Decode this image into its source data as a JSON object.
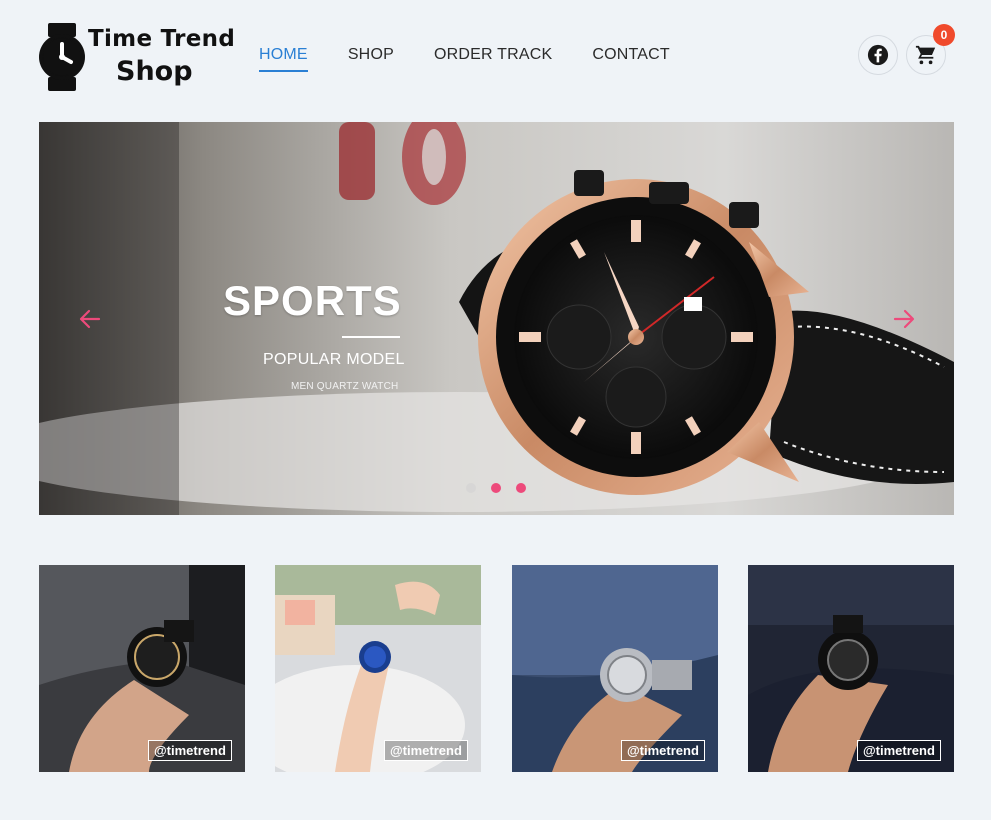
{
  "brand": {
    "line1": "Time Trend",
    "line2": "Shop"
  },
  "nav": {
    "items": [
      {
        "label": "HOME",
        "active": true
      },
      {
        "label": "SHOP",
        "active": false
      },
      {
        "label": "ORDER TRACK",
        "active": false
      },
      {
        "label": "CONTACT",
        "active": false
      }
    ]
  },
  "header_actions": {
    "facebook_icon": "facebook-icon",
    "cart_icon": "cart-icon",
    "cart_count": "0"
  },
  "hero": {
    "title": "SPORTS",
    "subtitle": "POPULAR MODEL",
    "caption": "MEN QUARTZ WATCH",
    "slides_total": 3,
    "active_slide": 2,
    "prev_icon": "arrow-left-icon",
    "next_icon": "arrow-right-icon"
  },
  "gallery": {
    "tiles": [
      {
        "tag": "@timetrend"
      },
      {
        "tag": "@timetrend"
      },
      {
        "tag": "@timetrend"
      },
      {
        "tag": "@timetrend"
      }
    ]
  },
  "colors": {
    "accent": "#2a7fd4",
    "badge": "#f04a2c",
    "slider_dot": "#ed4a7b",
    "background": "#eff3f7"
  }
}
